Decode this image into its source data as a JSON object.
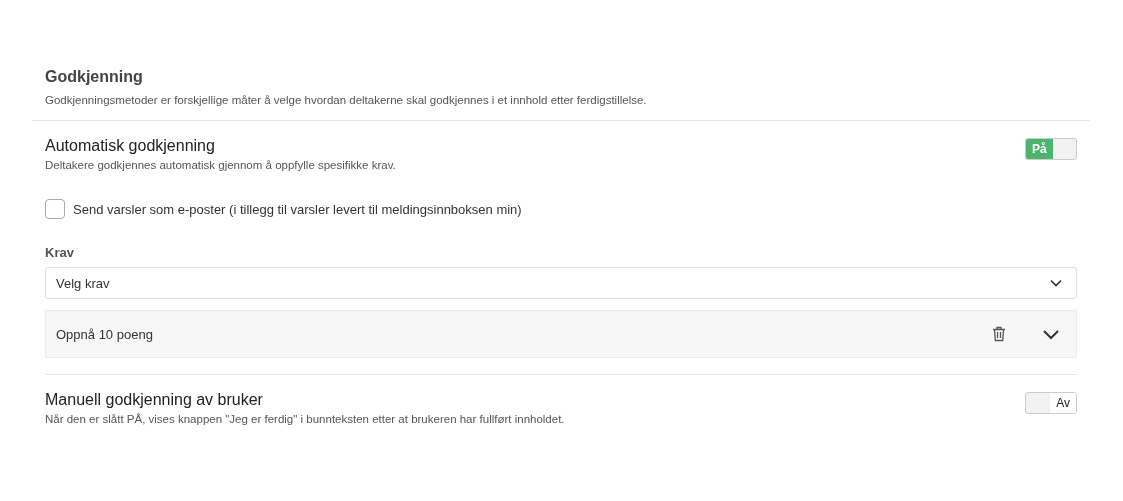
{
  "section": {
    "title": "Godkjenning",
    "description": "Godkjenningsmetoder er forskjellige måter å velge hvordan deltakerne skal godkjennes i et innhold etter ferdigstillelse."
  },
  "automatic": {
    "title": "Automatisk godkjenning",
    "description": "Deltakere godkjennes automatisk gjennom å oppfylle spesifikke krav.",
    "toggle": {
      "on": true,
      "label": "På"
    }
  },
  "email_option": {
    "label": "Send varsler som e-poster (i tillegg til varsler levert til meldingsinnboksen min)",
    "checked": false
  },
  "requirements": {
    "label": "Krav",
    "select": {
      "value": "Velg krav"
    },
    "items": [
      {
        "label": "Oppnå 10 poeng",
        "expanded": false
      }
    ]
  },
  "manual": {
    "title": "Manuell godkjenning av bruker",
    "description": "Når den er slått PÅ, vises knappen \"Jeg er ferdig\" i bunnteksten etter at brukeren har fullført innholdet.",
    "toggle": {
      "on": false,
      "label": "Av"
    }
  }
}
